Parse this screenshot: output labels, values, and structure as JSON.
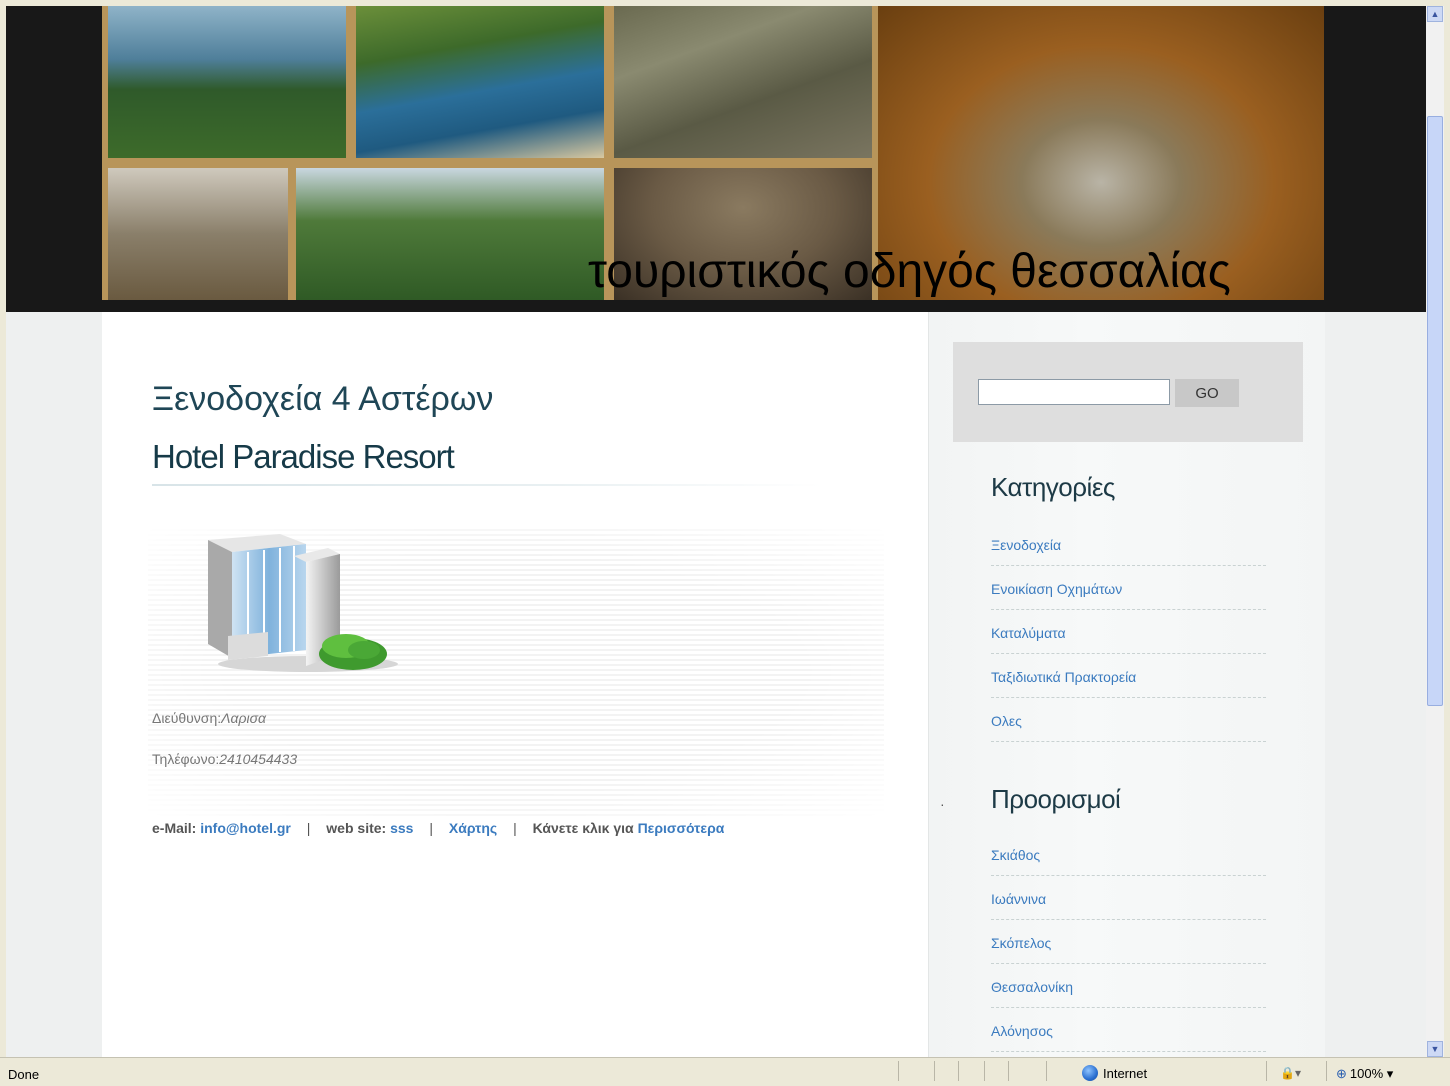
{
  "banner": {
    "title": "τουριστικός οδηγός θεσσαλίας"
  },
  "main": {
    "heading": "Ξενοδοχεία 4 Αστέρων",
    "hotel_name": "Hotel Paradise Resort",
    "address_label": "Διεύθυνση:",
    "address_value": "Λαρισα",
    "phone_label": "Τηλέφωνο:",
    "phone_value": "2410454433",
    "links": {
      "email_label": "e-Mail:",
      "email_value": "info@hotel.gr",
      "website_label": "web site:",
      "website_value": "sss",
      "map_link": "Χάρτης",
      "more_label": "Κάνετε κλικ για",
      "more_link": "Περισσότερα",
      "separator": "|"
    }
  },
  "sidebar": {
    "search": {
      "value": "",
      "go_label": "GO"
    },
    "categories": {
      "heading": "Κατηγορίες",
      "items": [
        "Ξενοδοχεία",
        "Ενοικίαση Οχημάτων",
        "Καταλύματα",
        "Ταξιδιωτικά Πρακτορεία",
        "Ολες"
      ]
    },
    "destinations": {
      "heading": "Προορισμοί",
      "items": [
        "Σκιάθος",
        "Ιωάννινα",
        "Σκόπελος",
        "Θεσσαλονίκη",
        "Αλόνησος"
      ]
    },
    "dot": "·"
  },
  "statusbar": {
    "status": "Done",
    "zone": "Internet",
    "zoom": "100%"
  },
  "icons": {
    "building": "building-icon",
    "globe": "globe-icon",
    "zoom": "zoom-icon",
    "security": "security-icon"
  }
}
